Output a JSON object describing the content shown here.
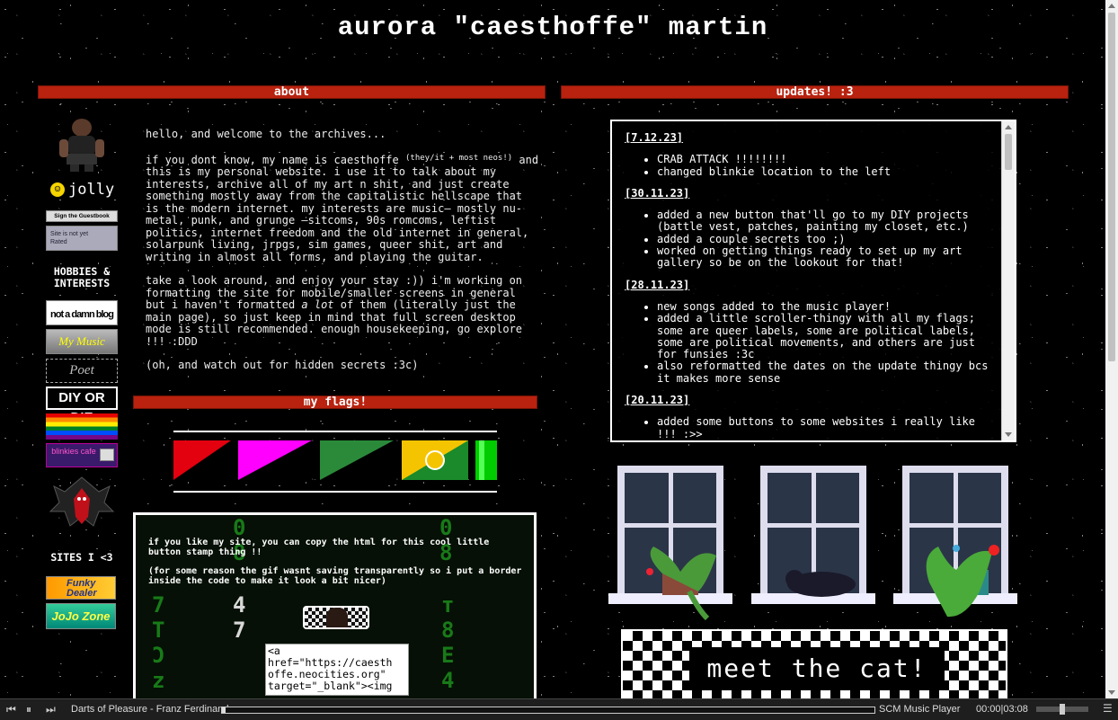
{
  "header": {
    "title": "aurora \"caesthoffe\" martin"
  },
  "sections": {
    "about": "about",
    "updates": "updates! :3",
    "flags": "my flags!"
  },
  "left_column": {
    "jolly_label": "jolly",
    "guestbook_label": "Sign the Guestbook",
    "not_rated_label": "Site is not yet Rated",
    "hobbies_heading": "HOBBIES & INTERESTS",
    "blog_button": "not a damn blog",
    "music_button": "My Music",
    "poet_button": "Poet",
    "diy_button": "DIY OR DIE",
    "blinkies_button": "blinkies cafe",
    "sites_heading": "SITES I <3",
    "funky_button": "Funky Dealer",
    "jojo_button": "JoJo Zone"
  },
  "about": {
    "p1": "hello, and welcome to the archives...",
    "p2_before": "if you dont know, my name is caesthoffe ",
    "p2_pronouns": "(they/it + most neos!)",
    "p2_after": " and this is my personal website. i use it to talk about my interests, archive all of my art n shit, and just create something mostly away from the capitalistic hellscape that is the modern internet. my interests are music— mostly nu-metal, punk, and grunge —sitcoms, 90s romcoms, leftist politics, internet freedom and the old internet in general, solarpunk living, jrpgs, sim games, queer shit, art and writing in almost all forms, and playing the guitar.",
    "p3_before": "take a look around, and enjoy your stay :)) i'm working on formatting the site for mobile/smaller screens in general but i haven't formatted ",
    "p3_em": "a lot",
    "p3_after": " of them (literally just the main page), so just keep in mind that full screen desktop mode is still recommended. enough housekeeping, go explore !!! :DDD",
    "p4": "(oh, and watch out for hidden secrets :3c)"
  },
  "updates": [
    {
      "date": "[7.12.23]",
      "items": [
        "CRAB ATTACK !!!!!!!!",
        "changed blinkie location to the left"
      ]
    },
    {
      "date": "[30.11.23]",
      "items": [
        "added a new button that'll go to my DIY projects (battle vest, patches, painting my closet, etc.)",
        "added a couple secrets too ;)",
        "worked on getting things ready to set up my art gallery so be on the lookout for that!"
      ]
    },
    {
      "date": "[28.11.23]",
      "items": [
        "new songs added to the music player!",
        "added a little scroller-thingy with all my flags; some are queer labels, some are political labels, some are political movements, and others are just for funsies :3c",
        "also reformatted the dates on the update thingy bcs it makes more sense"
      ]
    },
    {
      "date": "[20.11.23]",
      "items": [
        "added some buttons to some websites i really like !!! :>>"
      ]
    }
  ],
  "stamp": {
    "line1": "if you like my site, you can copy the html for this cool little button stamp thing !!",
    "line2": "(for some reason the gif wasnt saving transparently so i put a border inside the code to make it look a bit nicer)",
    "code": "<a href=\"https://caesthoffe.neocities.org\" target=\"_blank\"><img"
  },
  "cat": {
    "label": "meet the cat!"
  },
  "player": {
    "track": "Darts of Pleasure - Franz Ferdinand",
    "name": "SCM Music Player",
    "time": "00:00|03:08",
    "progress": 0.005,
    "volume": 0.5
  },
  "colors": {
    "accent_bar": "#b8220f",
    "matrix_green": "#27d127"
  }
}
